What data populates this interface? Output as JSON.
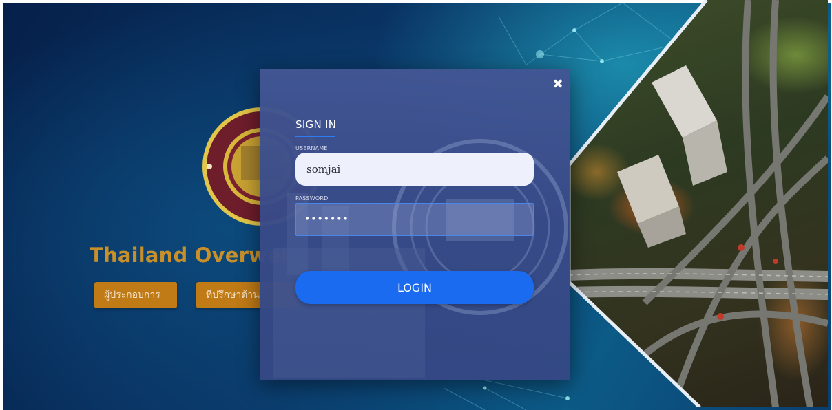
{
  "colors": {
    "accent": "#1a6bf0",
    "gold": "#c9902a",
    "button_orange": "#c07a16",
    "modal_bg": "#3f5592"
  },
  "background": {
    "hero_title": "Thailand Overwei",
    "buttons": [
      {
        "label": "ผู้ประกอบการ"
      },
      {
        "label": "ที่ปรึกษาด้านก"
      }
    ]
  },
  "modal": {
    "close_icon": "close-icon",
    "title": "SIGN IN",
    "username_label": "USERNAME",
    "username_value": "somjai",
    "password_label": "PASSWORD",
    "password_value": "somjai1",
    "login_label": "LOGIN"
  }
}
